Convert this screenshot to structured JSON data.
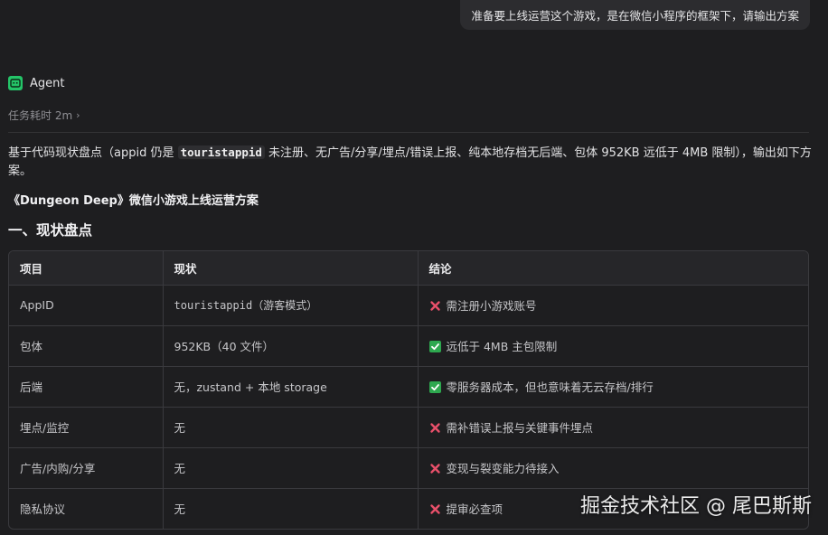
{
  "user_message": "准备要上线运营这个游戏，是在微信小程序的框架下，请输出方案",
  "agent": {
    "name": "Agent",
    "icon": "robot-icon",
    "accent": "#24c468"
  },
  "task_time": "任务耗时 2m",
  "intro": {
    "part1": "基于代码现状盘点（appid 仍是 ",
    "code": "touristappid",
    "part2": " 未注册、无广告/分享/埋点/错误上报、纯本地存档无后端、包体 952KB 远低于 4MB 限制），输出如下方案。"
  },
  "plan_title": "《Dungeon Deep》微信小游戏上线运营方案",
  "section_heading": "一、现状盘点",
  "table": {
    "headers": [
      "项目",
      "现状",
      "结论"
    ],
    "rows": [
      {
        "item": "AppID",
        "status": "touristappid（游客模式）",
        "conclusion": "需注册小游戏账号",
        "mark": "cross"
      },
      {
        "item": "包体",
        "status": "952KB（40 文件）",
        "conclusion": "远低于 4MB 主包限制",
        "mark": "check"
      },
      {
        "item": "后端",
        "status": "无，zustand + 本地 storage",
        "conclusion": "零服务器成本，但也意味着无云存档/排行",
        "mark": "check"
      },
      {
        "item": "埋点/监控",
        "status": "无",
        "conclusion": "需补错误上报与关键事件埋点",
        "mark": "cross"
      },
      {
        "item": "广告/内购/分享",
        "status": "无",
        "conclusion": "变现与裂变能力待接入",
        "mark": "cross"
      },
      {
        "item": "隐私协议",
        "status": "无",
        "conclusion": "提审必查项",
        "mark": "cross"
      }
    ]
  },
  "watermark": "掘金技术社区 @ 尾巴斯斯",
  "colors": {
    "cross": "#e8506a",
    "check": "#2ea84f"
  }
}
